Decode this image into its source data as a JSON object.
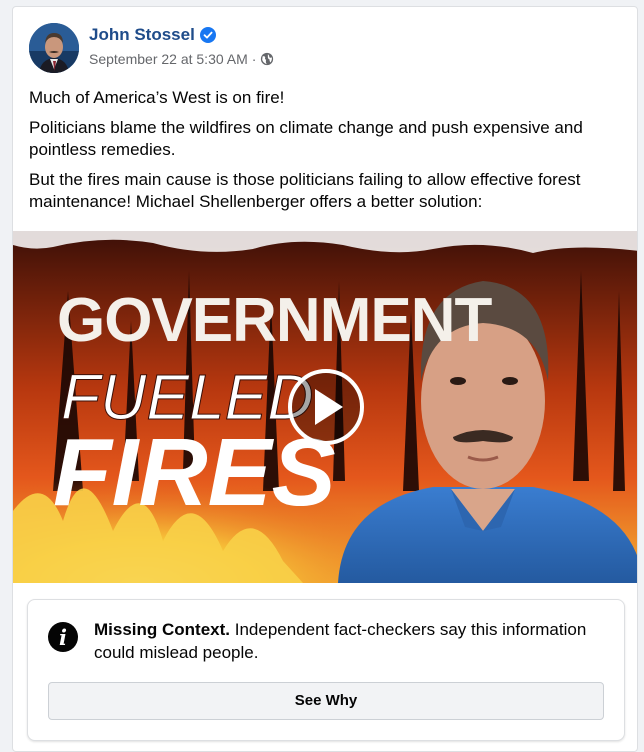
{
  "post": {
    "author": "John Stossel",
    "timestamp": "September 22 at 5:30 AM",
    "separator": "·",
    "audience_icon": "globe-icon",
    "verified_icon": "verified-badge-icon",
    "paragraphs": [
      "Much of America’s West is on fire!",
      "Politicians blame the wildfires on climate change and push expensive and pointless remedies.",
      "But the fires main cause is those politicians failing to allow effective forest maintenance! Michael Shellenberger offers a better solution:"
    ]
  },
  "video": {
    "title_line1": "GOVERNMENT",
    "title_line2": "FUELED",
    "title_line3": "FIRES",
    "play_icon": "play-icon"
  },
  "fact_check": {
    "icon": "info-icon",
    "title": "Missing Context.",
    "message": "Independent fact-checkers say this information could mislead people.",
    "button_label": "See Why"
  },
  "colors": {
    "author": "#1f4c8a",
    "verified": "#1877f2",
    "meta": "#65676b",
    "fire_orange": "#e4571c",
    "shirt_blue": "#2f6fbe"
  }
}
